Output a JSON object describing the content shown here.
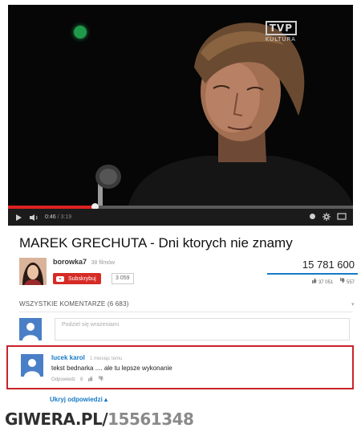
{
  "video": {
    "channel_logo_main": "TVP",
    "channel_logo_sub": "KULTURA",
    "time_current": "0:46",
    "time_separator": " / ",
    "time_total": "3:19",
    "progress_played": 0.25,
    "icons": [
      "play-icon",
      "volume-icon",
      "settings-icon",
      "fullscreen-icon"
    ]
  },
  "title": "MAREK GRECHUTA - Dni ktorych nie znamy",
  "channel": {
    "name": "borowka7",
    "video_count": "38 filmów",
    "subscribe_label": "Subskrybuj",
    "subscriber_count": "3 059"
  },
  "stats": {
    "views": "15 781 600",
    "likes": "37 051",
    "dislikes": "557"
  },
  "comments": {
    "header": "WSZYSTKIE KOMENTARZE (6 683)",
    "share_placeholder": "Podziel się wrażeniami",
    "items": [
      {
        "author": "lucek karol",
        "time": "1 miesiąc temu",
        "text": "tekst bednarka .... ale tu lepsze wykonanie",
        "reply_label": "Odpowiedz",
        "like_count": "8"
      }
    ],
    "toggle_replies": "Ukryj odpowiedzi"
  },
  "watermark": {
    "site": "GIWERA.PL/",
    "id": "15561348"
  },
  "colors": {
    "accent": "#167ac6",
    "subscribe": "#d62b25",
    "highlight": "#c9232b",
    "watermark_site": "#2f2f2f",
    "watermark_id": "#8a8a8a"
  }
}
